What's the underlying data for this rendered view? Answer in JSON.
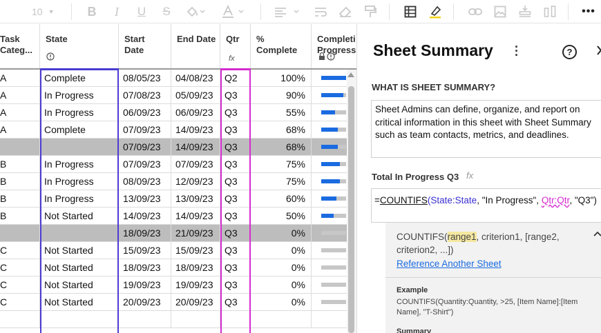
{
  "toolbar": {
    "font_size": "10",
    "icons": [
      "bold-icon",
      "italic-icon",
      "underline-icon",
      "strikethrough-icon",
      "fill-color-icon",
      "text-color-icon",
      "align-icon",
      "wrap-icon",
      "eraser-icon",
      "format-painter-icon",
      "grid-icon",
      "highlight-icon",
      "link-icon",
      "image-icon",
      "insert-row-icon",
      "column-width-icon",
      "more-icon"
    ]
  },
  "grid": {
    "headers": {
      "category": "Task Categ...",
      "state": "State",
      "start_date": "Start Date",
      "end_date": "End Date",
      "qtr": "Qtr",
      "qtr_sub": "fx",
      "pct_complete": "% Complete",
      "completion": "Completi Progress"
    },
    "rows": [
      {
        "cat": "A",
        "state": "Complete",
        "start": "08/05/23",
        "end": "04/08/23",
        "qtr": "Q2",
        "pct": "100%",
        "progress": 1.0,
        "parent": false
      },
      {
        "cat": "A",
        "state": "In Progress",
        "start": "07/08/23",
        "end": "05/09/23",
        "qtr": "Q3",
        "pct": "90%",
        "progress": 0.9,
        "parent": false
      },
      {
        "cat": "A",
        "state": "In Progress",
        "start": "06/09/23",
        "end": "06/09/23",
        "qtr": "Q3",
        "pct": "55%",
        "progress": 0.55,
        "parent": false
      },
      {
        "cat": "A",
        "state": "Complete",
        "start": "07/09/23",
        "end": "14/09/23",
        "qtr": "Q3",
        "pct": "68%",
        "progress": 0.68,
        "parent": false
      },
      {
        "cat": "",
        "state": "",
        "start": "07/09/23",
        "end": "14/09/23",
        "qtr": "Q3",
        "pct": "68%",
        "progress": 0.68,
        "parent": true
      },
      {
        "cat": "B",
        "state": "In Progress",
        "start": "07/09/23",
        "end": "07/09/23",
        "qtr": "Q3",
        "pct": "75%",
        "progress": 0.75,
        "parent": false
      },
      {
        "cat": "B",
        "state": "In Progress",
        "start": "08/09/23",
        "end": "12/09/23",
        "qtr": "Q3",
        "pct": "75%",
        "progress": 0.75,
        "parent": false
      },
      {
        "cat": "B",
        "state": "In Progress",
        "start": "13/09/23",
        "end": "13/09/23",
        "qtr": "Q3",
        "pct": "60%",
        "progress": 0.6,
        "parent": false
      },
      {
        "cat": "B",
        "state": "Not Started",
        "start": "14/09/23",
        "end": "14/09/23",
        "qtr": "Q3",
        "pct": "50%",
        "progress": 0.5,
        "parent": false
      },
      {
        "cat": "",
        "state": "",
        "start": "18/09/23",
        "end": "21/09/23",
        "qtr": "Q3",
        "pct": "0%",
        "progress": 0.0,
        "parent": true
      },
      {
        "cat": "C",
        "state": "Not Started",
        "start": "15/09/23",
        "end": "15/09/23",
        "qtr": "Q3",
        "pct": "0%",
        "progress": 0.0,
        "parent": false
      },
      {
        "cat": "C",
        "state": "Not Started",
        "start": "18/09/23",
        "end": "18/09/23",
        "qtr": "Q3",
        "pct": "0%",
        "progress": 0.0,
        "parent": false
      },
      {
        "cat": "C",
        "state": "Not Started",
        "start": "19/09/23",
        "end": "19/09/23",
        "qtr": "Q3",
        "pct": "0%",
        "progress": 0.0,
        "parent": false
      },
      {
        "cat": "C",
        "state": "Not Started",
        "start": "20/09/23",
        "end": "20/09/23",
        "qtr": "Q3",
        "pct": "0%",
        "progress": 0.0,
        "parent": false
      },
      {
        "cat": "",
        "state": "",
        "start": "",
        "end": "",
        "qtr": "",
        "pct": "",
        "progress": null,
        "parent": false
      }
    ],
    "colors": {
      "progress_fill": "#1a6be0",
      "progress_track": "#c7c7c7",
      "state_selection": "#4a3bd1",
      "qtr_selection": "#d42bd1",
      "parent_row": "#bdbdbd"
    }
  },
  "panel": {
    "title": "Sheet Summary",
    "help": "?",
    "section_label": "WHAT IS SHEET SUMMARY?",
    "description": "Sheet Admins can define, organize, and report on critical information in this sheet with Sheet Summary such as team contacts, metrics, and deadlines.",
    "field_label": "Total In Progress Q3",
    "field_fx": "fx",
    "formula": {
      "eq": "=",
      "fn": "COUNTIFS",
      "open": "(",
      "ref1": "State:State",
      "mid": ", \"In Progress\", ",
      "ref2": "Qtr:Qtr",
      "end": ", \"Q3\")"
    },
    "help_box": {
      "syntax_fn": "COUNTIFS(",
      "syntax_arg1": "range1",
      "syntax_rest": ", criterion1, [range2, criterion2, ...])",
      "reference_link": "Reference Another Sheet",
      "example_label": "Example",
      "example_text": "COUNTIFS(Quantity:Quantity, >25, [Item Name]:[Item Name], \"T-Shirt\")",
      "summary_label": "Summary"
    }
  }
}
